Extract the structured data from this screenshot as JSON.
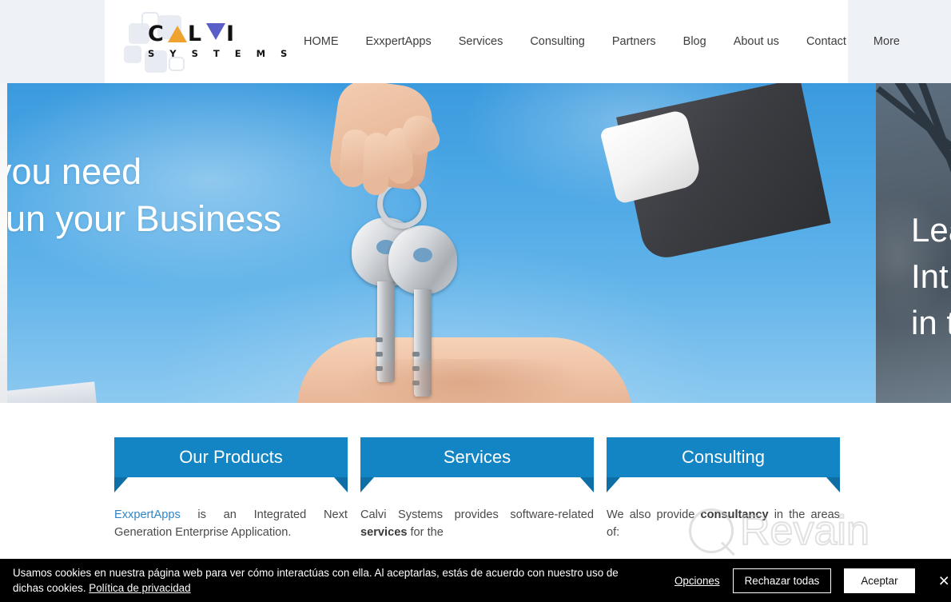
{
  "header": {
    "logo": {
      "name_part1": "C",
      "name_part2": "L",
      "name_part3": "I",
      "subtitle": "S Y S T E M S",
      "triangle_up_color": "#f0a22e",
      "triangle_down_color": "#5a5fc7"
    },
    "nav": [
      {
        "label": "HOME"
      },
      {
        "label": "ExxpertApps"
      },
      {
        "label": "Services"
      },
      {
        "label": "Consulting"
      },
      {
        "label": "Partners"
      },
      {
        "label": "Blog"
      },
      {
        "label": "About us"
      },
      {
        "label": "Contact"
      },
      {
        "label": "More"
      }
    ]
  },
  "hero": {
    "current_slide": {
      "line1": "you need",
      "line2": "run your  Business"
    },
    "next_slide": {
      "line1": "Lea",
      "line2": "Int",
      "line3": "in t"
    }
  },
  "cards": [
    {
      "title": "Our Products",
      "body_link": "ExxpertApps",
      "body_rest": " is an Integrated Next Generation Enterprise Application."
    },
    {
      "title": "Services",
      "body_pre": "Calvi Systems provides software-related ",
      "body_bold": "services",
      "body_post": " for the"
    },
    {
      "title": "Consulting",
      "body_pre": "We also provide ",
      "body_bold": "consultancy",
      "body_post": " in the areas of:"
    }
  ],
  "watermark": {
    "text": "Revain"
  },
  "cookie_banner": {
    "message": "Usamos cookies en nuestra página web para ver cómo interactúas con ella. Al aceptarlas, estás de acuerdo con nuestro uso de dichas cookies. ",
    "policy_link": "Política de privacidad",
    "options_label": "Opciones",
    "reject_label": "Rechazar todas",
    "accept_label": "Aceptar",
    "close_icon": "×"
  },
  "colors": {
    "accent_blue": "#1485c4",
    "accent_blue_dark": "#0d6fa6",
    "link_blue": "#2e86c8",
    "header_band": "#eef1f6",
    "cookie_bg": "#000000"
  }
}
